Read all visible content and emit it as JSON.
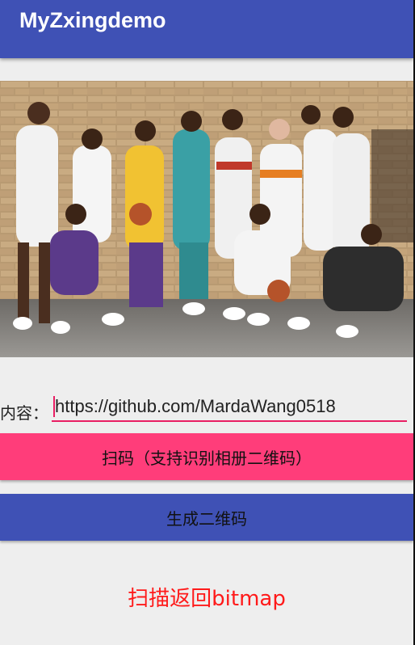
{
  "appbar": {
    "title": "MyZxingdemo"
  },
  "photo": {
    "description_icon": "team-photo-image"
  },
  "content": {
    "label": "内容：",
    "value": "https://github.com/MardaWang0518"
  },
  "buttons": {
    "scan_label": "扫码（支持识别相册二维码）",
    "generate_label": "生成二维码"
  },
  "result": {
    "text": "扫描返回bitmap"
  },
  "colors": {
    "primary": "#3f51b5",
    "accent": "#ff3d7a",
    "result_text": "#ff1a1a"
  }
}
